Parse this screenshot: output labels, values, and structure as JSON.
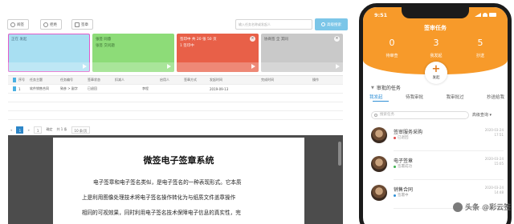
{
  "admin": {
    "toolbar": {
      "btn_view": "阅签",
      "btn_reject": "拒绝",
      "btn_sign": "签章"
    },
    "search": {
      "placeholder": "输入任务名称或发起人",
      "button": "高级搜索"
    },
    "cards": [
      {
        "line1": "正在 发起",
        "line2": "",
        "color": "#a8dff2",
        "text_color": "#4a6f80",
        "border": "#e25ac9"
      },
      {
        "line1": "张签 同意",
        "line2": "张签 交问题",
        "color": "#8ddc78",
        "text_color": "#2f5f2a"
      },
      {
        "line1": "签印中 共 20 张 50 页",
        "line2": "1 签印中",
        "color": "#e86048",
        "text_color": "#ffffff"
      },
      {
        "line1": "协商签 全 其同",
        "line2": "",
        "color": "#c9c9c9",
        "text_color": "#555555"
      }
    ],
    "table": {
      "headers": [
        "",
        "序号",
        "任务主题",
        "任务编号",
        "签章状态",
        "扣减人",
        "",
        "启用人",
        "签章方式",
        "发起时间",
        "",
        "完成时间",
        "",
        "操作"
      ],
      "rows": [
        [
          "",
          "1",
          "软件销售合同",
          "致彦 > 副字",
          "已退回",
          "",
          "李程",
          "",
          "",
          "2019-09-13",
          "",
          "",
          "",
          ""
        ]
      ]
    },
    "pager": {
      "first": "«",
      "page": "1",
      "last": "»",
      "goto": "1",
      "go": "确定",
      "total": "共 1 条",
      "size": "10 条/页"
    },
    "doc": {
      "title": "微签电子签章系统",
      "lines": [
        "电子签章和电子签名类似，是电子签名的一种表现形式。它本质",
        "上是利用图像处理技术将电子签名操作转化为与纸质文件盖章操作",
        "相同的可视效果，同时利用电子签名技术保障电子信息的真实性，完"
      ]
    }
  },
  "phone": {
    "time": "9:51",
    "title": "签审任务",
    "stats": [
      {
        "num": "0",
        "label": "待审查"
      },
      {
        "num": "3",
        "label": "我发起"
      },
      {
        "num": "5",
        "label": "抄送"
      }
    ],
    "fab_label": "发起",
    "section": "审批的任务",
    "tabs": [
      "我发起",
      "待我审批",
      "我审批过",
      "抄送给我"
    ],
    "search_placeholder": "搜索任务",
    "advanced": "高级查询",
    "items": [
      {
        "name": "签审服务采购",
        "status": "已退回",
        "status_color": "#e24b4b",
        "date": "2020-03-24",
        "time": "17:51"
      },
      {
        "name": "电子签章",
        "status": "签署成功",
        "status_color": "#3fb34f",
        "date": "2020-03-24",
        "time": "15:05"
      },
      {
        "name": "销售合同",
        "status": "签署中",
        "status_color": "#2f8fd6",
        "date": "2020-03-24",
        "time": "14:48"
      }
    ]
  },
  "watermark": "头条 @彩云签"
}
